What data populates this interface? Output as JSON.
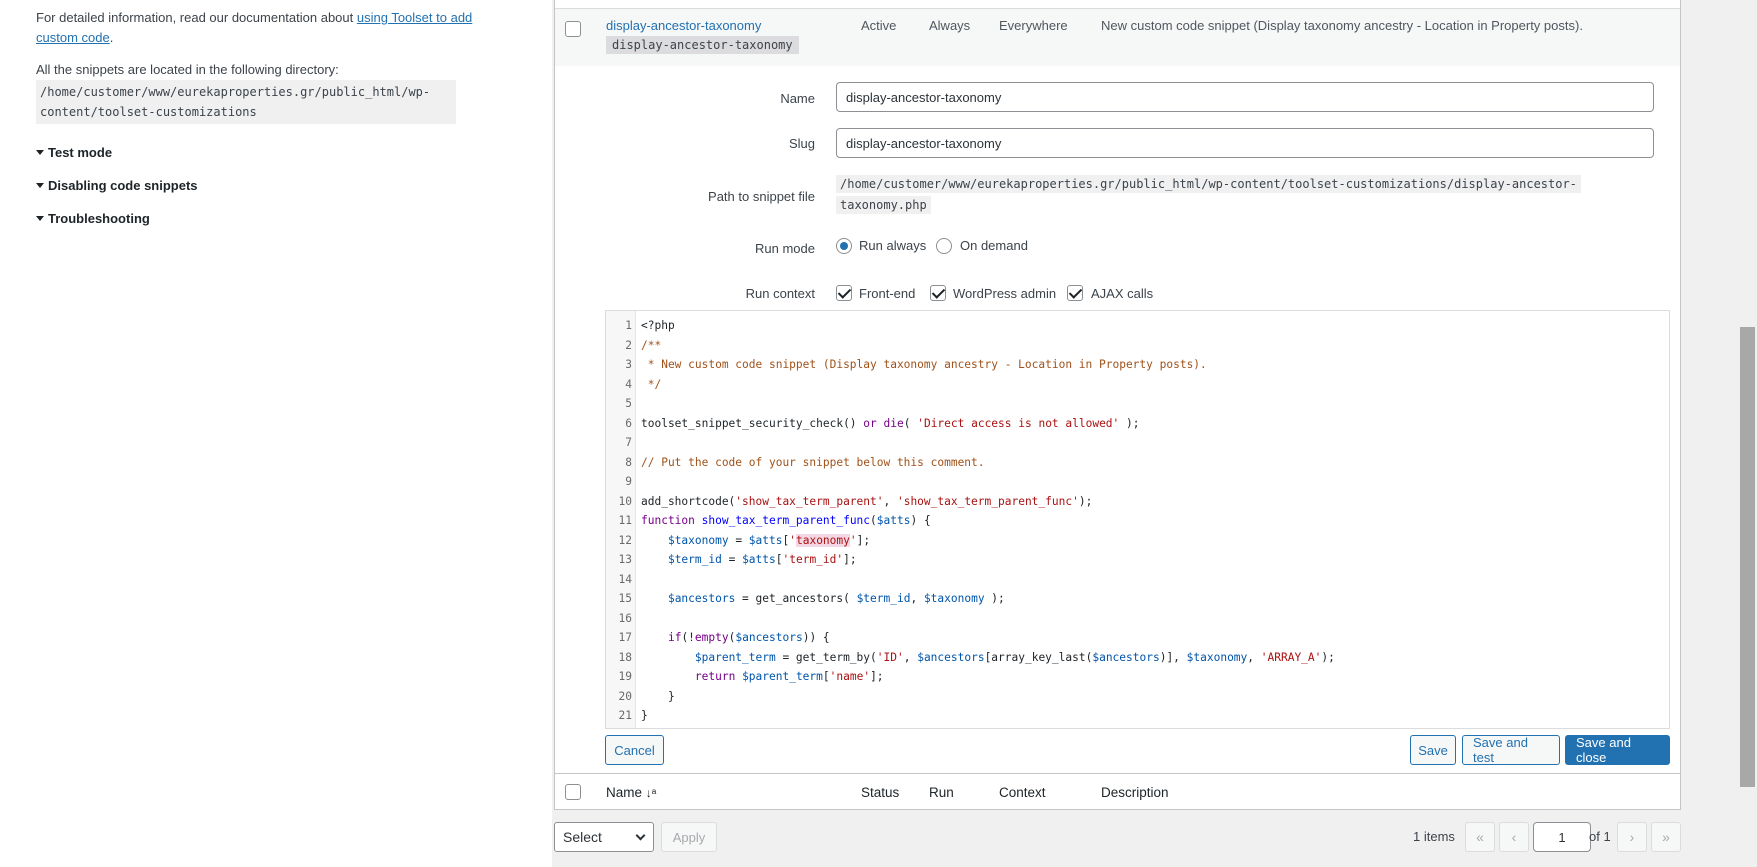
{
  "help": {
    "para1_prefix": "For detailed information, read our documentation about ",
    "para1_link": "using Toolset to add custom code",
    "para1_suffix": ".",
    "para2": "All the snippets are located in the following directory:",
    "directory": "/home/customer/www/eurekaproperties.gr/public_html/wp-content/toolset-customizations",
    "toggles": [
      "Test mode",
      "Disabling code snippets",
      "Troubleshooting"
    ]
  },
  "snippet": {
    "title": "display-ancestor-taxonomy",
    "slug_chip": "display-ancestor-taxonomy",
    "status": "Active",
    "run": "Always",
    "context": "Everywhere",
    "description": "New custom code snippet (Display taxonomy ancestry - Location in Property posts)."
  },
  "form": {
    "name_label": "Name",
    "name_value": "display-ancestor-taxonomy",
    "slug_label": "Slug",
    "slug_value": "display-ancestor-taxonomy",
    "path_label": "Path to snippet file",
    "path_line1": "/home/customer/www/eurekaproperties.gr/public_html/wp-content/toolset-customizations/display-ancestor-",
    "path_line2": "taxonomy.php",
    "run_mode_label": "Run mode",
    "run_always": "Run always",
    "on_demand": "On demand",
    "run_context_label": "Run context",
    "frontend": "Front-end",
    "wp_admin": "WordPress admin",
    "ajax": "AJAX calls"
  },
  "buttons": {
    "cancel": "Cancel",
    "save": "Save",
    "save_test": "Save and test",
    "save_close": "Save and close"
  },
  "footer_columns": {
    "name": "Name",
    "sort_icon": "↓ᵃ",
    "status": "Status",
    "run": "Run",
    "context": "Context",
    "description": "Description"
  },
  "bulk": {
    "select": "Select",
    "apply": "Apply"
  },
  "pagination": {
    "items": "1 items",
    "first": "«",
    "prev": "‹",
    "current": "1",
    "of": "of 1",
    "next": "›",
    "last": "»"
  }
}
